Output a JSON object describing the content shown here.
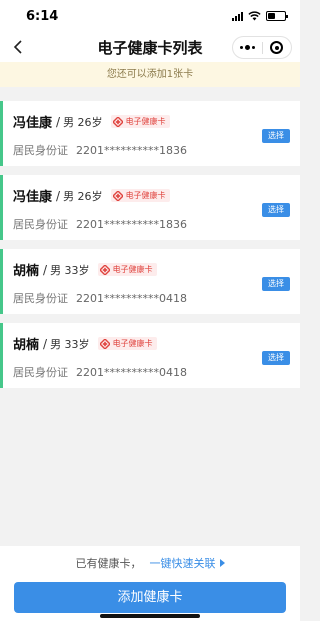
{
  "status_bar": {
    "time": "6:14"
  },
  "nav": {
    "title": "电子健康卡列表"
  },
  "notice": "您还可以添加1张卡",
  "cards": [
    {
      "name": "冯佳康",
      "info": "男 26岁",
      "tag": "电子健康卡",
      "id_label": "居民身份证",
      "id_number": "2201**********1836",
      "select_label": "选择"
    },
    {
      "name": "冯佳康",
      "info": "男 26岁",
      "tag": "电子健康卡",
      "id_label": "居民身份证",
      "id_number": "2201**********1836",
      "select_label": "选择"
    },
    {
      "name": "胡楠",
      "info": "男 33岁",
      "tag": "电子健康卡",
      "id_label": "居民身份证",
      "id_number": "2201**********0418",
      "select_label": "选择"
    },
    {
      "name": "胡楠",
      "info": "男 33岁",
      "tag": "电子健康卡",
      "id_label": "居民身份证",
      "id_number": "2201**********0418",
      "select_label": "选择"
    }
  ],
  "footer": {
    "has_card_text": "已有健康卡，",
    "quick_link": "一键快速关联",
    "add_button": "添加健康卡"
  },
  "colors": {
    "accent": "#3a8ee6",
    "card_stripe": "#46c78a",
    "tag": "#e0443f",
    "notice_bg": "#fdf7e2"
  }
}
